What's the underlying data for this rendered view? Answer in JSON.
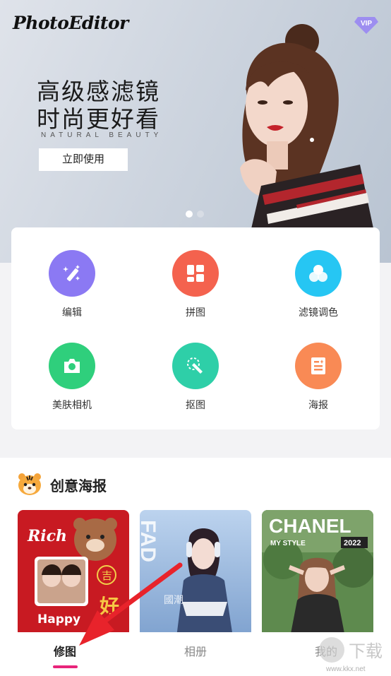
{
  "banner": {
    "logo": "PhotoEditor",
    "vip_label": "VIP",
    "headline_line1": "高级感滤镜",
    "headline_line2": "时尚更好看",
    "subline": "NATURAL  BEAUTY",
    "cta_label": "立即使用",
    "pagination": {
      "total": 2,
      "active": 1
    }
  },
  "tools": [
    {
      "label": "编辑",
      "color": "#8b79f3",
      "icon": "magic-wand-icon"
    },
    {
      "label": "拼图",
      "color": "#f4624e",
      "icon": "collage-icon"
    },
    {
      "label": "滤镜调色",
      "color": "#26c6f3",
      "icon": "filter-icon"
    },
    {
      "label": "美肤相机",
      "color": "#2fcf7c",
      "icon": "camera-icon"
    },
    {
      "label": "抠图",
      "color": "#2ecfa8",
      "icon": "cutout-icon"
    },
    {
      "label": "海报",
      "color": "#f98a55",
      "icon": "poster-icon"
    }
  ],
  "creative": {
    "title": "创意海报",
    "icon": "tiger-icon",
    "cards": [
      {
        "texts": [
          "Rich",
          "Happy",
          "吉",
          "好"
        ],
        "bg": "#c81a22"
      },
      {
        "texts": [
          "FAD",
          "國潮"
        ],
        "bg": "#9bbbe0"
      },
      {
        "texts": [
          "CHANEL",
          "MY STYLE",
          "2022"
        ],
        "bg": "#5e8a4e"
      }
    ]
  },
  "tabbar": {
    "tabs": [
      "修图",
      "相册",
      "我的"
    ],
    "active_index": 0,
    "accent": "#e8247a"
  },
  "watermark": {
    "text": "下载",
    "url": "www.kkx.net"
  }
}
